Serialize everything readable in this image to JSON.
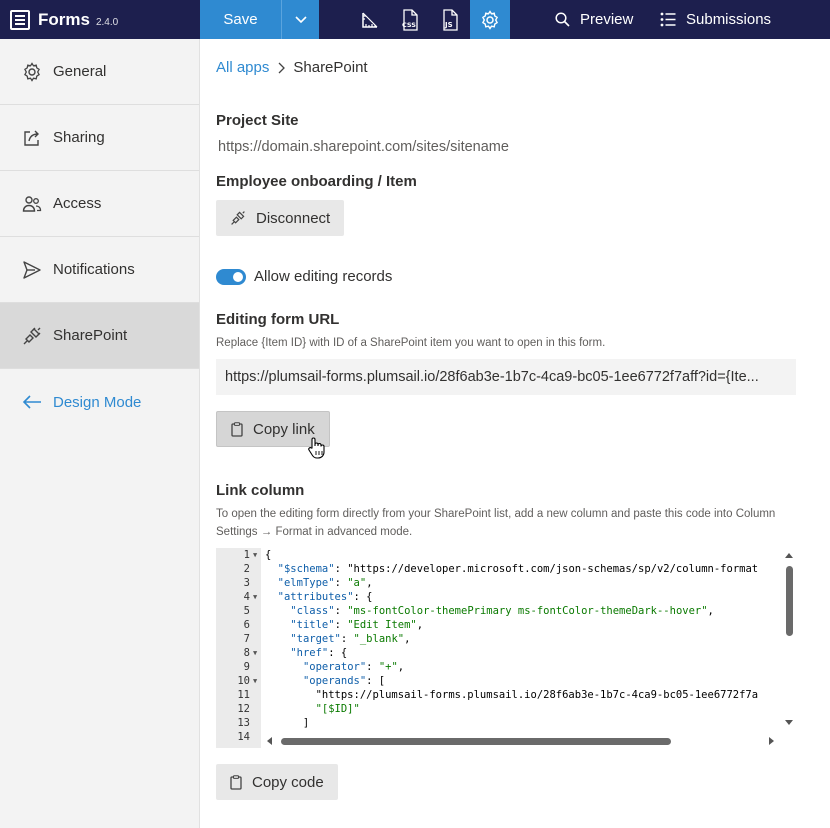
{
  "app": {
    "name": "Forms",
    "version": "2.4.0"
  },
  "toolbar": {
    "save_label": "Save",
    "preview_label": "Preview",
    "submissions_label": "Submissions"
  },
  "sidebar": {
    "items": [
      {
        "label": "General",
        "icon": "gear-icon"
      },
      {
        "label": "Sharing",
        "icon": "share-icon"
      },
      {
        "label": "Access",
        "icon": "users-icon"
      },
      {
        "label": "Notifications",
        "icon": "send-icon"
      },
      {
        "label": "SharePoint",
        "icon": "plug-icon",
        "active": true
      }
    ],
    "design_mode_label": "Design Mode"
  },
  "breadcrumb": {
    "root": "All apps",
    "current": "SharePoint"
  },
  "project_site": {
    "title": "Project Site",
    "url": "https://domain.sharepoint.com/sites/sitename"
  },
  "list": {
    "title": "Employee onboarding / Item",
    "disconnect_label": "Disconnect"
  },
  "allow_editing": {
    "label": "Allow editing records",
    "enabled": true
  },
  "editing_url": {
    "title": "Editing form URL",
    "help": "Replace {Item ID} with ID of a SharePoint item you want to open in this form.",
    "value": "https://plumsail-forms.plumsail.io/28f6ab3e-1b7c-4ca9-bc05-1ee6772f7aff?id={Ite...",
    "copy_label": "Copy link"
  },
  "link_column": {
    "title": "Link column",
    "help": "To open the editing form directly from your SharePoint list, add a new column and paste this code into Column Settings → Format in advanced mode.",
    "copy_label": "Copy code",
    "code_lines": [
      {
        "n": "1",
        "fold": true,
        "text": "{"
      },
      {
        "n": "2",
        "text": "  \"$schema\": \"https://developer.microsoft.com/json-schemas/sp/v2/column-format"
      },
      {
        "n": "3",
        "text": "  \"elmType\": \"a\","
      },
      {
        "n": "4",
        "fold": true,
        "text": "  \"attributes\": {"
      },
      {
        "n": "5",
        "text": "    \"class\": \"ms-fontColor-themePrimary ms-fontColor-themeDark--hover\","
      },
      {
        "n": "6",
        "text": "    \"title\": \"Edit Item\","
      },
      {
        "n": "7",
        "text": "    \"target\": \"_blank\","
      },
      {
        "n": "8",
        "fold": true,
        "text": "    \"href\": {"
      },
      {
        "n": "9",
        "text": "      \"operator\": \"+\","
      },
      {
        "n": "10",
        "fold": true,
        "text": "      \"operands\": ["
      },
      {
        "n": "11",
        "text": "        \"https://plumsail-forms.plumsail.io/28f6ab3e-1b7c-4ca9-bc05-1ee6772f7a"
      },
      {
        "n": "12",
        "text": "        \"[$ID]\""
      },
      {
        "n": "13",
        "text": "      ]"
      },
      {
        "n": "14",
        "text": ""
      }
    ]
  }
}
